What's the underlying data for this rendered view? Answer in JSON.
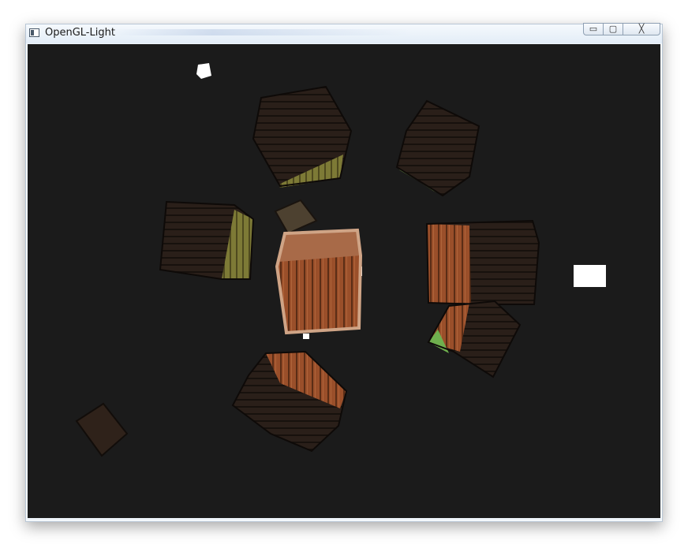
{
  "window": {
    "title": "OpenGL-Light",
    "icon": "app-window-icon",
    "controls": [
      {
        "name": "minimize",
        "glyph": "▭"
      },
      {
        "name": "maximize",
        "glyph": "▢"
      },
      {
        "name": "close",
        "glyph": "╳"
      }
    ]
  },
  "scene": {
    "background_color": "#1b1b1b",
    "objects": [
      "wooden-crate",
      "light-source-cube"
    ]
  }
}
